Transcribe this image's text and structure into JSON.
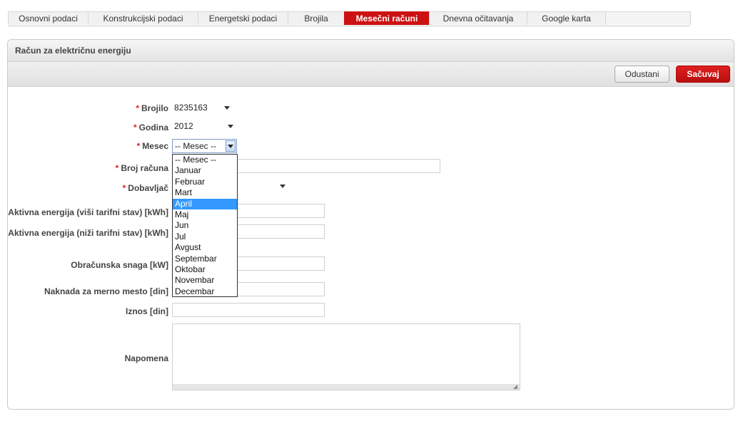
{
  "tabs": [
    {
      "label": "Osnovni podaci",
      "active": false
    },
    {
      "label": "Konstrukcijski podaci",
      "active": false
    },
    {
      "label": "Energetski podaci",
      "active": false
    },
    {
      "label": "Brojila",
      "active": false
    },
    {
      "label": "Mesečni računi",
      "active": true
    },
    {
      "label": "Dnevna očitavanja",
      "active": false
    },
    {
      "label": "Google karta",
      "active": false
    }
  ],
  "panel": {
    "title": "Račun za električnu energiju"
  },
  "toolbar": {
    "cancel_label": "Odustani",
    "save_label": "Sačuvaj"
  },
  "required_marker": "*",
  "form": {
    "brojilo": {
      "label": "Brojilo",
      "value": "8235163"
    },
    "godina": {
      "label": "Godina",
      "value": "2012"
    },
    "mesec": {
      "label": "Mesec",
      "value": "-- Mesec --"
    },
    "broj_racuna": {
      "label": "Broj računa",
      "value": ""
    },
    "dobavljac": {
      "label": "Dobavljač",
      "value": ""
    },
    "aktivna_visi": {
      "label": "Aktivna energija (viši tarifni stav) [kWh]",
      "value": ""
    },
    "aktivna_nizi": {
      "label": "Aktivna energija (niži tarifni stav) [kWh]",
      "value": ""
    },
    "obracunska_snaga": {
      "label": "Obračunska snaga [kW]",
      "value": ""
    },
    "naknada": {
      "label": "Naknada za merno mesto [din]",
      "value": ""
    },
    "iznos": {
      "label": "Iznos [din]",
      "value": ""
    },
    "napomena": {
      "label": "Napomena",
      "value": ""
    }
  },
  "month_dropdown": {
    "options": [
      "-- Mesec --",
      "Januar",
      "Februar",
      "Mart",
      "April",
      "Maj",
      "Jun",
      "Jul",
      "Avgust",
      "Septembar",
      "Oktobar",
      "Novembar",
      "Decembar"
    ],
    "highlighted": "April"
  },
  "colors": {
    "accent": "#cc1111",
    "required": "#e02020",
    "highlight": "#3399ff"
  }
}
